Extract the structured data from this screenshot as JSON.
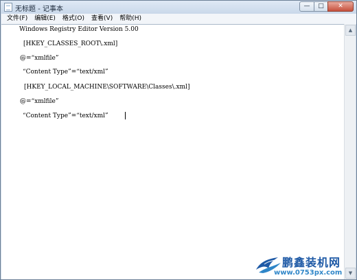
{
  "window": {
    "title": "无标题 - 记事本",
    "buttons": {
      "minimize": "—",
      "maximize": "□",
      "close": "✕"
    }
  },
  "menu": {
    "items": [
      "文件(F)",
      "编辑(E)",
      "格式(O)",
      "查看(V)",
      "帮助(H)"
    ]
  },
  "editor": {
    "lines": [
      "Windows Registry Editor Version 5.00",
      "[HKEY_CLASSES_ROOT\\.xml]",
      "@=“xmlfile”",
      "“Content Type”=“text/xml”",
      "[HKEY_LOCAL_MACHINE\\SOFTWARE\\Classes\\.xml]",
      "@=“xmlfile”",
      "“Content Type”=“text/xml”"
    ]
  },
  "watermark": {
    "title": "鹏鑫装机网",
    "url": "www.0753px.com"
  },
  "icons": {
    "app": "notepad-icon",
    "logo": "bird-logo-icon"
  },
  "colors": {
    "titlebar": "#cfdbe8",
    "close_button": "#c6503c",
    "watermark_title": "#1f5aa6",
    "watermark_url": "#2f86c8"
  }
}
